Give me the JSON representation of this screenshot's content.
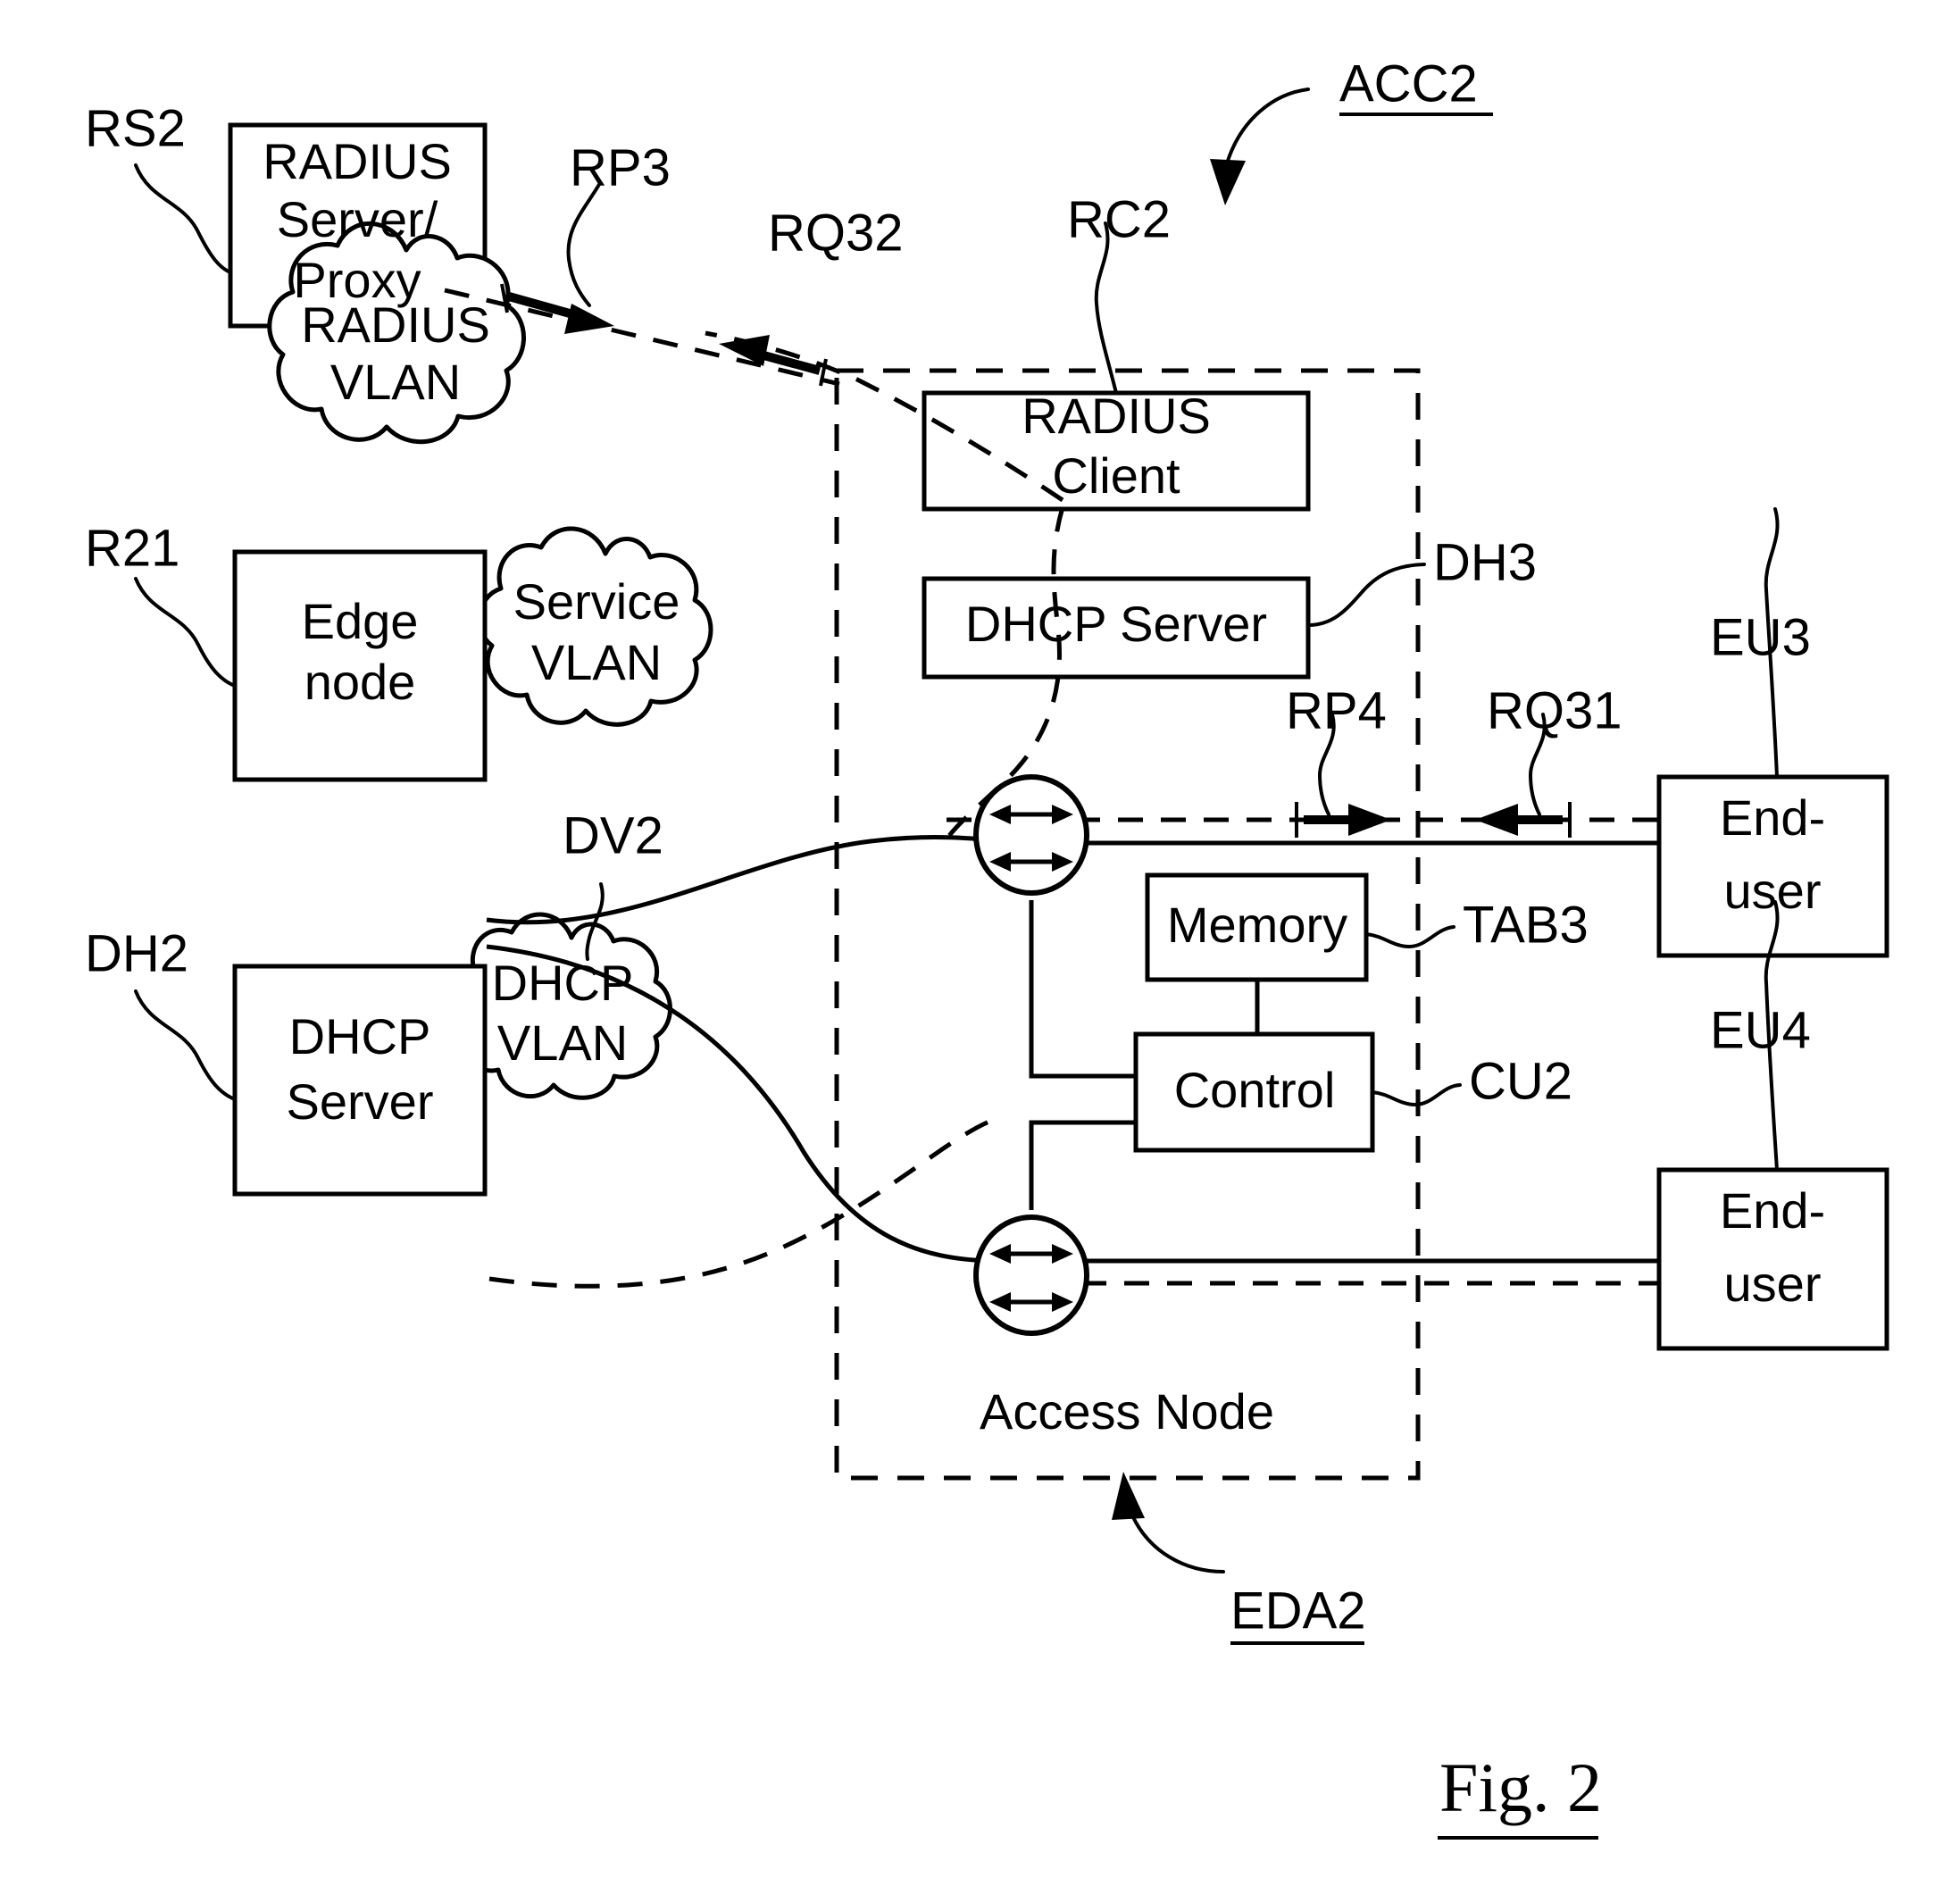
{
  "figure": {
    "caption": "Fig. 2",
    "title_ref": "ACC2",
    "access_node_ref": "EDA2"
  },
  "nodes": {
    "radius_server": {
      "ref": "RS2",
      "line1": "RADIUS",
      "line2": "Server/",
      "line3": "Proxy"
    },
    "radius_vlan": {
      "ref": "RP3",
      "line1": "RADIUS",
      "line2": "VLAN"
    },
    "edge_node": {
      "ref": "R21",
      "line1": "Edge",
      "line2": "node"
    },
    "service_vlan": {
      "line1": "Service",
      "line2": "VLAN"
    },
    "dhcp_server_ext": {
      "ref": "DH2",
      "line1": "DHCP",
      "line2": "Server"
    },
    "dhcp_vlan": {
      "ref": "DV2",
      "line1": "DHCP",
      "line2": "VLAN"
    },
    "radius_client": {
      "ref": "RC2",
      "line1": "RADIUS",
      "line2": "Client"
    },
    "dhcp_server_int": {
      "ref": "DH3",
      "label": "DHCP Server"
    },
    "memory": {
      "ref": "TAB3",
      "label": "Memory"
    },
    "control": {
      "ref": "CU2",
      "label": "Control"
    },
    "access_node": {
      "label": "Access Node"
    },
    "end_user_top": {
      "ref": "EU3",
      "line1": "End-",
      "line2": "user"
    },
    "end_user_bottom": {
      "ref": "EU4",
      "line1": "End-",
      "line2": "user"
    }
  },
  "flow_refs": {
    "rq32": "RQ32",
    "rp4": "RP4",
    "rq31": "RQ31"
  },
  "colors": {
    "ink": "#000000",
    "paper": "#ffffff"
  }
}
